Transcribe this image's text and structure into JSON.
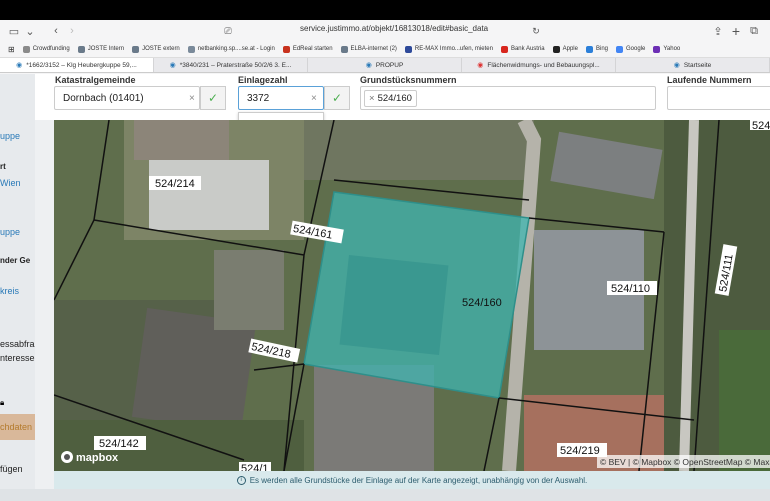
{
  "browser": {
    "url": "service.justimmo.at/objekt/16813018/edit#basic_data",
    "favorites": [
      {
        "label": "Crowdfunding",
        "color": "#8a8a8a"
      },
      {
        "label": "JOSTE Intern",
        "color": "#6a7a8a"
      },
      {
        "label": "JOSTE extern",
        "color": "#6a7a8a"
      },
      {
        "label": "netbanking.sp....se.at - Login",
        "color": "#7a8a9a"
      },
      {
        "label": "EdReal starten",
        "color": "#c8321e"
      },
      {
        "label": "ELBA-internet (2)",
        "color": "#6a7a8a"
      },
      {
        "label": "RE-MAX Immo...ufen, mieten",
        "color": "#2e4a9a"
      },
      {
        "label": "Bank Austria",
        "color": "#d8261e"
      },
      {
        "label": "Apple",
        "color": "#222222"
      },
      {
        "label": "Bing",
        "color": "#2b7fd9"
      },
      {
        "label": "Google",
        "color": "#4285f4"
      },
      {
        "label": "Yahoo",
        "color": "#6d2fb5"
      }
    ],
    "tabs": [
      {
        "label": "*1662/3152 – Klg Heubergkuppe 59,...",
        "active": true
      },
      {
        "label": "*3840/231 – Praterstraße 50/2/6 3. E...",
        "active": false
      },
      {
        "label": "PROPUP",
        "active": false
      },
      {
        "label": "Flächenwidmungs- und Bebauungspl...",
        "active": false
      },
      {
        "label": "Startseite",
        "active": false
      }
    ]
  },
  "sidebar": {
    "items": [
      "uppe",
      "rt",
      "Wien",
      "uppe",
      "nder Ge",
      "kreis",
      "essabfra",
      "nteresse",
      "chdaten",
      "fügen",
      "monitor"
    ]
  },
  "form": {
    "katastral_label": "Katastralgemeinde",
    "katastral_value": "Dornbach (01401)",
    "einlage_label": "Einlagezahl",
    "einlage_value": "3372",
    "grund_label": "Grundstücksnummern",
    "grund_chip": "524/160",
    "laufende_label": "Laufende Nummern",
    "dropdown_option": "3372"
  },
  "map": {
    "parcel_labels": [
      "524/214",
      "524/161",
      "524/160",
      "524/110",
      "524/111",
      "524/218",
      "524/142",
      "524/219",
      "524/1",
      "524"
    ],
    "attribution": "© BEV | © Mapbox © OpenStreetMap © Maxar",
    "logo": "mapbox",
    "highlight_color": "#3fb5b0"
  },
  "notice": "Es werden alle Grundstücke der Einlage auf der Karte angezeigt, unabhängig von der Auswahl."
}
